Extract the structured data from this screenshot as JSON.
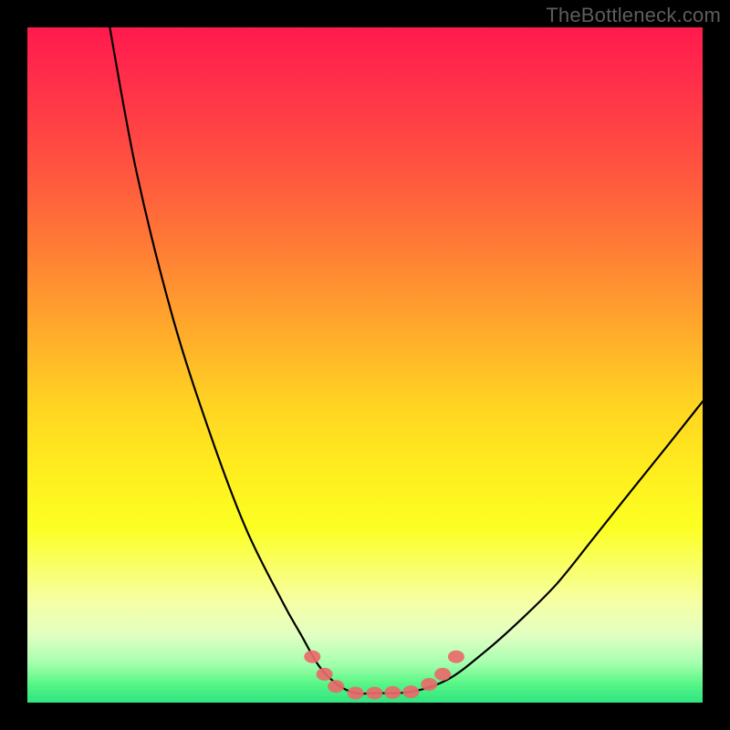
{
  "watermark": {
    "text": "TheBottleneck.com"
  },
  "chart_data": {
    "type": "line",
    "title": "",
    "xlabel": "",
    "ylabel": "",
    "xlim": [
      0,
      100
    ],
    "ylim": [
      0,
      100
    ],
    "grid": false,
    "legend": false,
    "series": [
      {
        "name": "bottleneck-curve",
        "x": [
          12.2,
          16.2,
          21.6,
          27.0,
          32.4,
          37.8,
          40.5,
          43.2,
          45.9,
          48.6,
          51.4,
          56.8,
          62.2,
          67.6,
          73.0,
          78.4,
          83.8,
          89.2,
          94.6,
          100.0
        ],
        "y": [
          100.0,
          78.4,
          56.8,
          40.0,
          25.7,
          14.9,
          10.1,
          5.4,
          2.7,
          1.4,
          1.4,
          1.6,
          3.4,
          7.4,
          12.2,
          17.6,
          24.3,
          31.1,
          37.8,
          44.6
        ]
      }
    ],
    "markers": [
      {
        "name": "marker-left-1",
        "x": 42.2,
        "y": 6.8
      },
      {
        "name": "marker-left-2",
        "x": 44.0,
        "y": 4.2
      },
      {
        "name": "marker-left-3",
        "x": 45.7,
        "y": 2.4
      },
      {
        "name": "marker-center-1",
        "x": 48.6,
        "y": 1.4
      },
      {
        "name": "marker-center-2",
        "x": 51.4,
        "y": 1.4
      },
      {
        "name": "marker-center-3",
        "x": 54.1,
        "y": 1.5
      },
      {
        "name": "marker-center-4",
        "x": 56.8,
        "y": 1.6
      },
      {
        "name": "marker-right-1",
        "x": 59.5,
        "y": 2.7
      },
      {
        "name": "marker-right-2",
        "x": 61.5,
        "y": 4.2
      },
      {
        "name": "marker-right-3",
        "x": 63.5,
        "y": 6.8
      }
    ],
    "gradient_stops": [
      {
        "offset": 0,
        "color": "#ff1a4d"
      },
      {
        "offset": 56,
        "color": "#ffd422"
      },
      {
        "offset": 100,
        "color": "#2fe57f"
      }
    ]
  }
}
